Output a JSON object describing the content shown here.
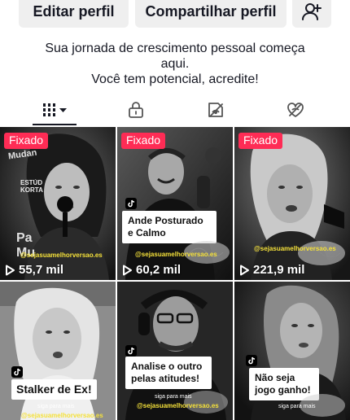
{
  "actions": {
    "edit_profile": "Editar perfil",
    "share_profile": "Compartilhar perfil",
    "add_friend_icon": "person-plus-icon"
  },
  "bio": {
    "line1": "Sua jornada de crescimento pessoal começa",
    "line2": "aqui.",
    "line3": "Você tem potencial, acredite!"
  },
  "tabs": [
    {
      "icon": "videos-grid-icon",
      "has_dropdown": true,
      "active": true
    },
    {
      "icon": "lock-icon",
      "active": false
    },
    {
      "icon": "reposts-hidden-icon",
      "active": false
    },
    {
      "icon": "liked-hidden-icon",
      "active": false
    }
  ],
  "videos": [
    {
      "pinned_label": "Fixado",
      "views": "55,7 mil",
      "handle": "@sejasuamelhorversao.es",
      "overlay_left": "ESTÚD\nKORTA",
      "overlay_bottom": "Pa\nMu"
    },
    {
      "pinned_label": "Fixado",
      "views": "60,2 mil",
      "caption": "Ande Posturado e Calmo",
      "handle": "@sejasuamelhorversao.es"
    },
    {
      "pinned_label": "Fixado",
      "views": "221,9 mil",
      "handle": "@sejasuamelhorversao.es"
    },
    {
      "caption": "Stalker de Ex!",
      "follow_text": "siga para mais",
      "handle": "@sejasuamelhorversao.es"
    },
    {
      "caption": "Analise o outro pelas atitudes!",
      "follow_text": "siga para mais",
      "handle": "@sejasuamelhorversao.es"
    },
    {
      "caption": "Não seja jogo ganho!",
      "follow_text": "siga para mais"
    }
  ],
  "colors": {
    "pinned_badge": "#fe2c55",
    "handle_text": "#f5e13a",
    "button_bg": "#efefef",
    "text_primary": "#161823"
  }
}
